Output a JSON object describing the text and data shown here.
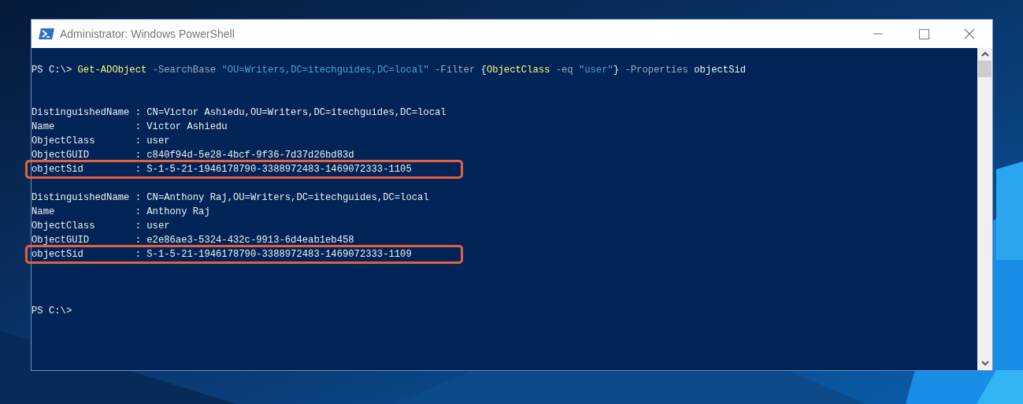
{
  "window": {
    "title": "Administrator: Windows PowerShell"
  },
  "command": {
    "prompt": "PS C:\\>",
    "tokens": [
      {
        "kind": "cmdlet",
        "text": "Get-ADObject"
      },
      {
        "kind": "param",
        "text": "-SearchBase"
      },
      {
        "kind": "string",
        "text": "\"OU=Writers,DC=itechguides,DC=local\""
      },
      {
        "kind": "param",
        "text": "-Filter"
      },
      {
        "parts": [
          {
            "kind": "plain",
            "text": "{"
          },
          {
            "kind": "cmdlet",
            "text": "ObjectClass"
          },
          {
            "kind": "param",
            "text": " -eq "
          },
          {
            "kind": "string",
            "text": "\"user\""
          },
          {
            "kind": "plain",
            "text": "}"
          }
        ]
      },
      {
        "kind": "param",
        "text": "-Properties"
      },
      {
        "kind": "plain",
        "text": "objectSid"
      }
    ]
  },
  "separator": ":",
  "records": [
    {
      "properties": [
        {
          "name": "DistinguishedName",
          "value": "CN=Victor Ashiedu,OU=Writers,DC=itechguides,DC=local",
          "highlighted": false
        },
        {
          "name": "Name",
          "value": "Victor Ashiedu",
          "highlighted": false
        },
        {
          "name": "ObjectClass",
          "value": "user",
          "highlighted": false
        },
        {
          "name": "ObjectGUID",
          "value": "c840f94d-5e28-4bcf-9f36-7d37d26bd83d",
          "highlighted": false
        },
        {
          "name": "objectSid",
          "value": "S-1-5-21-1946178790-3388972483-1469072333-1105",
          "highlighted": true
        }
      ]
    },
    {
      "properties": [
        {
          "name": "DistinguishedName",
          "value": "CN=Anthony Raj,OU=Writers,DC=itechguides,DC=local",
          "highlighted": false
        },
        {
          "name": "Name",
          "value": "Anthony Raj",
          "highlighted": false
        },
        {
          "name": "ObjectClass",
          "value": "user",
          "highlighted": false
        },
        {
          "name": "ObjectGUID",
          "value": "e2e86ae3-5324-432c-9913-6d4eab1eb458",
          "highlighted": false
        },
        {
          "name": "objectSid",
          "value": "S-1-5-21-1946178790-3388972483-1469072333-1109",
          "highlighted": true
        }
      ]
    }
  ],
  "final_prompt": "PS C:\\>"
}
